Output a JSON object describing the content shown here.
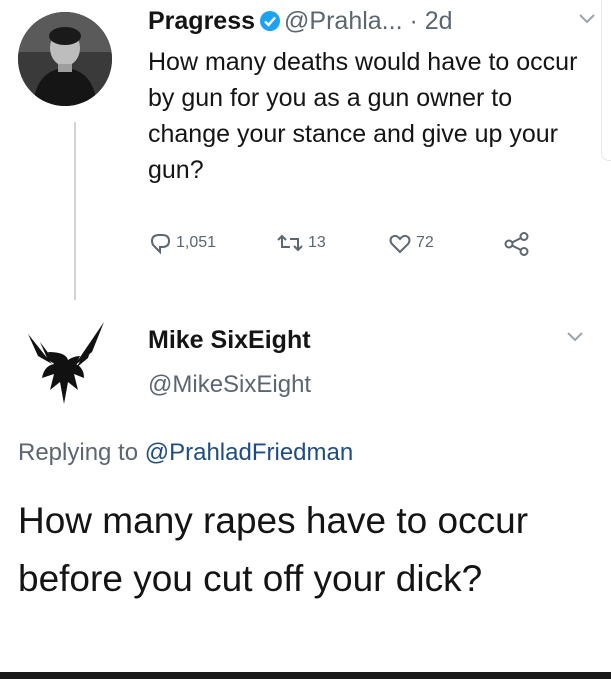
{
  "tweet1": {
    "display_name": "Pragress",
    "handle": "@Prahla...",
    "time": "· 2d",
    "text": "How many deaths would have to occur by gun for you as a gun owner to change your stance and give up your gun?",
    "replies": "1,051",
    "retweets": "13",
    "likes": "72",
    "verified": true
  },
  "tweet2": {
    "display_name": "Mike SixEight",
    "handle": "@MikeSixEight",
    "replying_prefix": "Replying to",
    "replying_mention": "@PrahladFriedman",
    "text": "How many rapes have to occur before you cut off your dick?"
  },
  "colors": {
    "text": "#141414",
    "muted": "#5c6670",
    "verified_blue": "#1da1f2",
    "mention": "#1f4d80",
    "thread_line": "#cfd4d8"
  },
  "icons": [
    "verified-icon",
    "chevron-down-icon",
    "reply-icon",
    "retweet-icon",
    "like-icon",
    "share-icon",
    "eagle-avatar-icon"
  ]
}
